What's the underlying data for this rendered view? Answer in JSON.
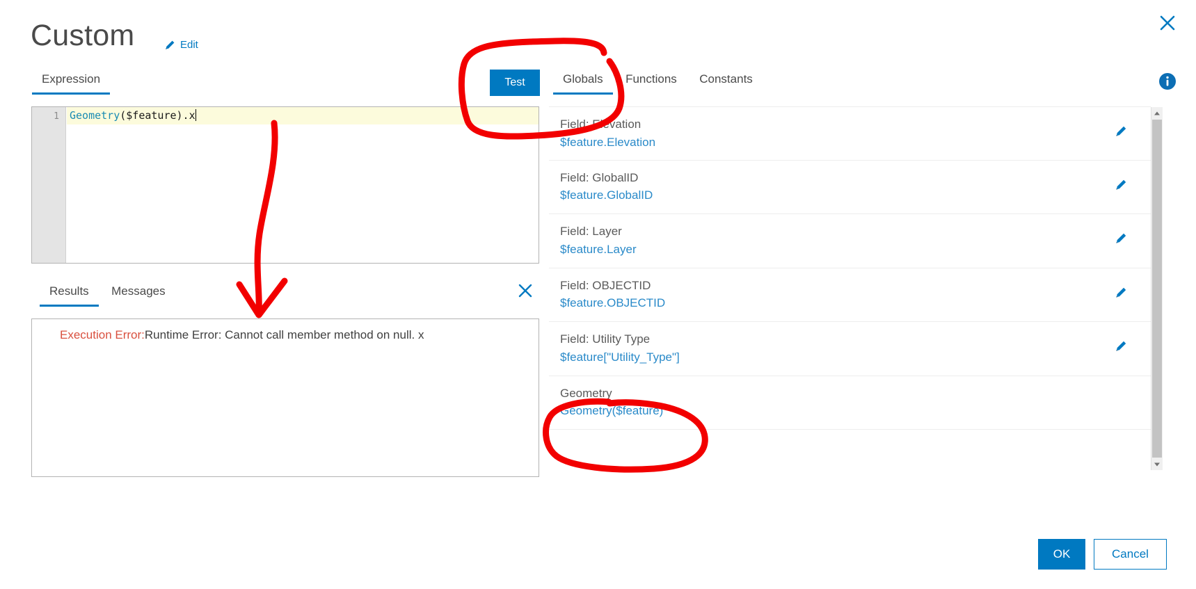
{
  "dialog": {
    "title": "Custom",
    "edit_label": "Edit",
    "close_icon": "close-icon",
    "info_icon": "info-icon"
  },
  "left_pane": {
    "tabs": [
      {
        "label": "Expression",
        "active": true
      }
    ],
    "test_button_label": "Test",
    "editor": {
      "line_number": "1",
      "code_function": "Geometry",
      "code_rest": "($feature).x"
    },
    "results": {
      "tabs": [
        {
          "label": "Results",
          "active": true
        },
        {
          "label": "Messages",
          "active": false
        }
      ],
      "close_icon": "close-icon",
      "error_label": "Execution Error:",
      "error_message": "Runtime Error: Cannot call member method on null. x"
    }
  },
  "right_pane": {
    "tabs": [
      {
        "label": "Globals",
        "active": true
      },
      {
        "label": "Functions",
        "active": false
      },
      {
        "label": "Constants",
        "active": false
      }
    ],
    "globals": [
      {
        "title": "Field: Elevation",
        "expression": "$feature.Elevation",
        "edit_icon": "pencil-icon"
      },
      {
        "title": "Field: GlobalID",
        "expression": "$feature.GlobalID",
        "edit_icon": "pencil-icon"
      },
      {
        "title": "Field: Layer",
        "expression": "$feature.Layer",
        "edit_icon": "pencil-icon"
      },
      {
        "title": "Field: OBJECTID",
        "expression": "$feature.OBJECTID",
        "edit_icon": "pencil-icon"
      },
      {
        "title": "Field: Utility Type",
        "expression": "$feature[\"Utility_Type\"]",
        "edit_icon": "pencil-icon"
      },
      {
        "title": "Geometry",
        "expression": "Geometry($feature)",
        "edit_icon": ""
      }
    ],
    "scrollbar": {
      "up_icon": "caret-up-icon",
      "down_icon": "caret-down-icon"
    }
  },
  "footer": {
    "ok_label": "OK",
    "cancel_label": "Cancel"
  },
  "colors": {
    "accent": "#0079c1",
    "link": "#2a8ac9",
    "error": "#d9503f",
    "annotation": "#f20000",
    "code_highlight": "#fcfbdc"
  }
}
